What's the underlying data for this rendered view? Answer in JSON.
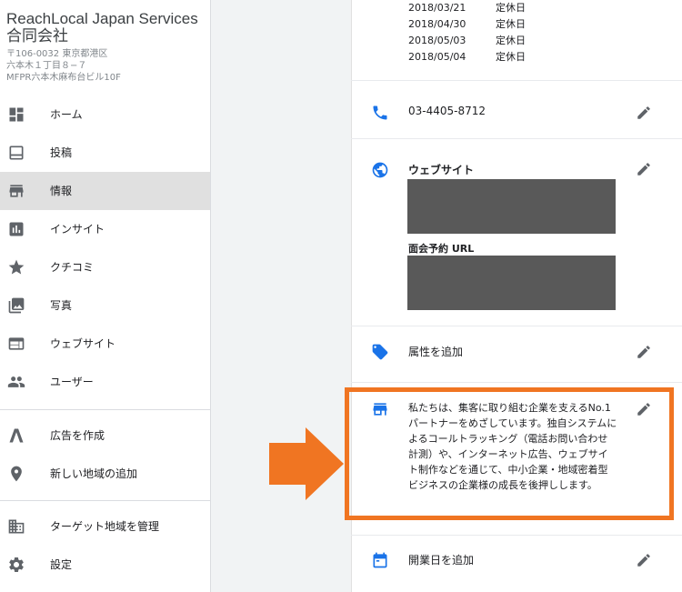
{
  "sidebar": {
    "business_name": "ReachLocal Japan Services 合同会社",
    "address": [
      "〒106-0032 東京都港区",
      "六本木１丁目８−７",
      "MFPR六本木麻布台ビル10F"
    ],
    "items": [
      {
        "label": "ホーム",
        "icon": "dashboard-icon"
      },
      {
        "label": "投稿",
        "icon": "post-icon"
      },
      {
        "label": "情報",
        "icon": "storefront-icon",
        "active": true
      },
      {
        "label": "インサイト",
        "icon": "insights-icon"
      },
      {
        "label": "クチコミ",
        "icon": "star-icon"
      },
      {
        "label": "写真",
        "icon": "photo-icon"
      },
      {
        "label": "ウェブサイト",
        "icon": "website-icon"
      },
      {
        "label": "ユーザー",
        "icon": "users-icon"
      },
      {
        "label": "広告を作成",
        "icon": "ads-icon"
      },
      {
        "label": "新しい地域の追加",
        "icon": "location-pin-icon"
      },
      {
        "label": "ターゲット地域を管理",
        "icon": "building-icon"
      },
      {
        "label": "設定",
        "icon": "gear-icon"
      }
    ]
  },
  "main": {
    "special_hours": [
      {
        "date": "2018/03/21",
        "status": "定休日"
      },
      {
        "date": "2018/04/30",
        "status": "定休日"
      },
      {
        "date": "2018/05/03",
        "status": "定休日"
      },
      {
        "date": "2018/05/04",
        "status": "定休日"
      }
    ],
    "phone": "03-4405-8712",
    "website_title": "ウェブサイト",
    "appointment_url_title": "面会予約 URL",
    "attributes_label": "属性を追加",
    "description": "私たちは、集客に取り組む企業を支えるNo.1パートナーをめざしています。独自システムによるコールトラッキング（電話お問い合わせ計測）や、インターネット広告、ウェブサイト制作などを通じて、中小企業・地域密着型ビジネスの企業様の成長を後押しします。",
    "opening_date_label": "開業日を追加"
  },
  "colors": {
    "accent_blue": "#1a73e8",
    "highlight_orange": "#f07522",
    "icon_gray": "#5f6368",
    "redaction": "#595959"
  }
}
